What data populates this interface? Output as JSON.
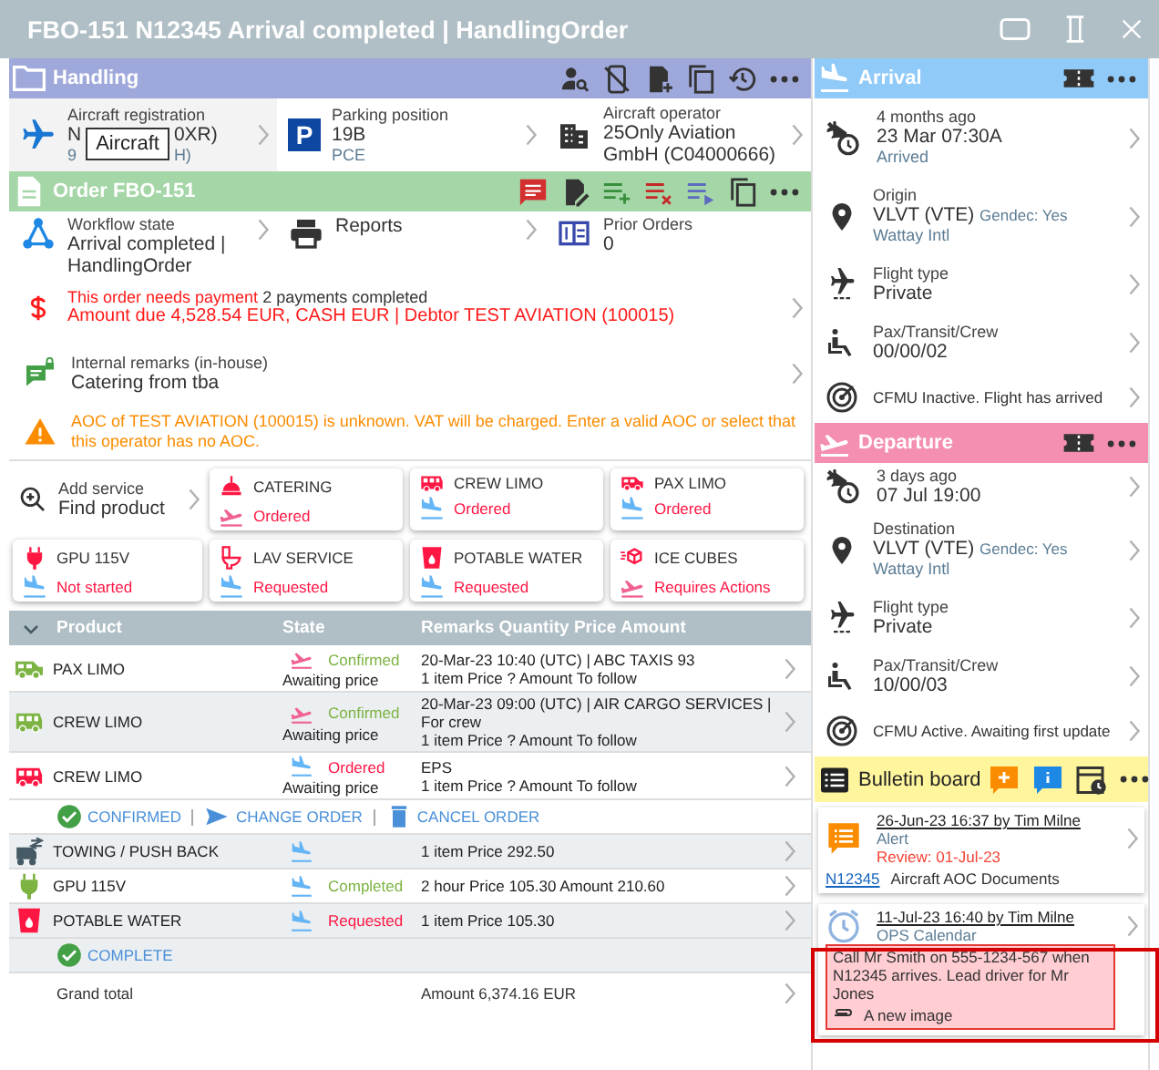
{
  "window": {
    "title": "FBO-151 N12345 Arrival completed | HandlingOrder"
  },
  "handling": {
    "title": "Handling",
    "registration": {
      "label": "Aircraft registration",
      "value_visible": [
        "N",
        "0XR)"
      ],
      "detail_visible": [
        "9",
        "H)"
      ],
      "tooltip": "Aircraft"
    },
    "parking": {
      "sign": "P",
      "label": "Parking position",
      "value": "19B",
      "detail": "PCE"
    },
    "operator": {
      "label": "Aircraft operator",
      "value": "25Only Aviation GmbH (C04000666)"
    }
  },
  "order": {
    "title": "Order FBO-151",
    "workflow": {
      "label": "Workflow state",
      "value": "Arrival completed | HandlingOrder"
    },
    "reports": {
      "label": "Reports"
    },
    "prior_orders": {
      "label": "Prior Orders",
      "value": "0"
    },
    "payment": {
      "alert": "This order needs payment",
      "note": "2 payments completed",
      "amount": "Amount due 4,528.54 EUR, CASH EUR | Debtor TEST AVIATION (100015)"
    },
    "remarks": {
      "label": "Internal remarks (in-house)",
      "value": "Catering from tba"
    },
    "warning": "AOC of TEST AVIATION (100015) is unknown. VAT will be charged. Enter a valid AOC or select that this operator has no AOC."
  },
  "services": {
    "add": {
      "label": "Add service",
      "value": "Find product"
    },
    "cards": [
      {
        "kind": "catering",
        "name": "CATERING",
        "status": "Ordered",
        "departure": true
      },
      {
        "kind": "van",
        "name": "CREW LIMO",
        "status": "Ordered",
        "departure": false
      },
      {
        "kind": "car",
        "name": "PAX LIMO",
        "status": "Ordered",
        "departure": false
      },
      {
        "kind": "plug",
        "name": "GPU 115V",
        "status": "Not started",
        "departure": false
      },
      {
        "kind": "toilet",
        "name": "LAV SERVICE",
        "status": "Requested",
        "departure": false
      },
      {
        "kind": "cup",
        "name": "POTABLE WATER",
        "status": "Requested",
        "departure": false
      },
      {
        "kind": "ice",
        "name": "ICE CUBES",
        "status": "Requires Actions",
        "departure": true
      }
    ]
  },
  "table": {
    "expanded": true,
    "columns": [
      "Product",
      "State",
      "Remarks Quantity Price Amount"
    ],
    "rows": [
      {
        "kind": "car",
        "color": "#7cb342",
        "name": "PAX LIMO",
        "departure": true,
        "state": "Confirmed",
        "price_note": "Awaiting price",
        "lines": [
          "20-Mar-23 10:40 (UTC) | ABC TAXIS 93",
          "1 item Price ? Amount To follow"
        ]
      },
      {
        "kind": "van",
        "color": "#7cb342",
        "name": "CREW LIMO",
        "departure": true,
        "state": "Confirmed",
        "price_note": "Awaiting price",
        "lines": [
          "20-Mar-23 09:00 (UTC) | AIR CARGO SERVICES | For crew",
          "1 item Price ? Amount To follow"
        ]
      },
      {
        "kind": "van",
        "color": "#ff1744",
        "name": "CREW LIMO",
        "departure": false,
        "state": "Ordered",
        "price_note": "Awaiting price",
        "lines": [
          "EPS",
          "1 item Price ? Amount To follow"
        ],
        "actions": [
          {
            "kind": "confirm",
            "label": "CONFIRMED"
          },
          {
            "kind": "change",
            "label": "CHANGE ORDER"
          },
          {
            "kind": "cancel",
            "label": "CANCEL ORDER"
          }
        ]
      },
      {
        "kind": "tow",
        "color": "#455a64",
        "name": "TOWING / PUSH BACK",
        "departure": false,
        "lines": [
          "1 item Price 292.50"
        ]
      },
      {
        "kind": "plug",
        "color": "#7cb342",
        "name": "GPU 115V",
        "departure": false,
        "state": "Completed",
        "lines": [
          "2 hour Price 105.30 Amount 210.60"
        ]
      },
      {
        "kind": "cup",
        "color": "#ff1744",
        "name": "POTABLE WATER",
        "departure": false,
        "state": "Requested",
        "lines": [
          "1 item Price 105.30"
        ],
        "actions": [
          {
            "kind": "confirm",
            "label": "COMPLETE"
          }
        ]
      }
    ],
    "total": {
      "label": "Grand total",
      "value": "Amount 6,374.16 EUR"
    }
  },
  "arrival": {
    "title": "Arrival",
    "time": {
      "ago": "4 months ago",
      "value": "23 Mar 07:30A",
      "status": "Arrived"
    },
    "place": {
      "label": "Origin",
      "value": "VLVT (VTE)",
      "gendec": "Gendec: Yes",
      "detail": "Wattay Intl"
    },
    "flight_type": {
      "label": "Flight type",
      "value": "Private"
    },
    "pax": {
      "label": "Pax/Transit/Crew",
      "value": "00/00/02"
    },
    "cfmu": "CFMU Inactive. Flight has arrived"
  },
  "departure": {
    "title": "Departure",
    "time": {
      "ago": "3 days ago",
      "value": "07 Jul 19:00"
    },
    "place": {
      "label": "Destination",
      "value": "VLVT (VTE)",
      "gendec": "Gendec: Yes",
      "detail": "Wattay Intl"
    },
    "flight_type": {
      "label": "Flight type",
      "value": "Private"
    },
    "pax": {
      "label": "Pax/Transit/Crew",
      "value": "10/00/03"
    },
    "cfmu": "CFMU Active. Awaiting first update"
  },
  "bulletin": {
    "title": "Bulletin board",
    "posts": [
      {
        "kind": "alert",
        "header": "26-Jun-23 16:37 by Tim Milne",
        "category": "Alert",
        "review": "Review: 01-Jul-23",
        "link": "N12345",
        "text": "Aircraft AOC Documents",
        "highlighted": false
      },
      {
        "kind": "calendar",
        "header": "11-Jul-23 16:40 by Tim Milne",
        "category": "OPS Calendar",
        "text": "Call Mr Smith on 555-1234-567 when N12345 arrives. Lead driver for Mr Jones",
        "attachment": "A new image",
        "highlighted": true
      }
    ]
  }
}
